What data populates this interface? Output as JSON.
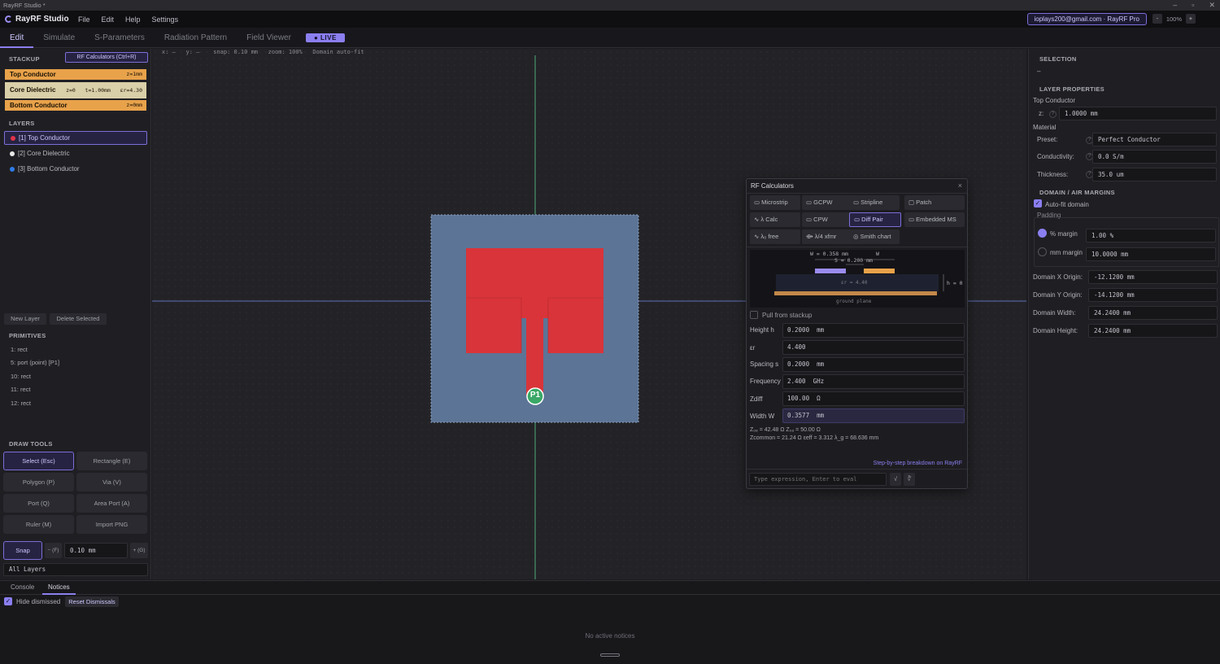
{
  "window": {
    "title": "RayRF Studio *"
  },
  "app": {
    "name": "RayRF Studio"
  },
  "menu": [
    "File",
    "Edit",
    "Help",
    "Settings"
  ],
  "account": {
    "label": "ioplays200@gmail.com · RayRF Pro"
  },
  "zoom": {
    "minus": "-",
    "value": "100%",
    "plus": "+"
  },
  "mode_tabs": [
    "Edit",
    "Simulate",
    "S-Parameters",
    "Radiation Pattern",
    "Field Viewer"
  ],
  "live_badge": "● LIVE",
  "stackup": {
    "heading": "STACKUP",
    "calc_button": "RF Calculators (Ctrl+R)",
    "rows": [
      {
        "name": "Top Conductor",
        "meta": "z=1mm",
        "color": "#e8a24a"
      },
      {
        "name": "Core Dielectric",
        "meta": "z=0   t=1.00mm   εr=4.30",
        "color": "#d9cfa8"
      },
      {
        "name": "Bottom Conductor",
        "meta": "z=0mm",
        "color": "#e8a24a"
      }
    ]
  },
  "layers": {
    "heading": "LAYERS",
    "items": [
      {
        "label": "[1] Top Conductor",
        "color": "#e0334a"
      },
      {
        "label": "[2] Core Dielectric",
        "color": "#e8e8e8"
      },
      {
        "label": "[3] Bottom Conductor",
        "color": "#2f7be6"
      }
    ],
    "new_button": "New Layer",
    "delete_button": "Delete Selected"
  },
  "primitives": {
    "heading": "PRIMITIVES",
    "items": [
      "1: rect",
      "5: port (point) [P1]",
      "10: rect",
      "11: rect",
      "12: rect"
    ]
  },
  "draw_tools": {
    "heading": "DRAW TOOLS",
    "tools": [
      "Select (Esc)",
      "Rectangle (E)",
      "Polygon (P)",
      "Via (V)",
      "Port (Q)",
      "Area Port (A)",
      "Ruler (M)",
      "Import PNG"
    ],
    "snap_label": "Snap",
    "snap_minus": "− (F)",
    "snap_value": "0.10 mm",
    "snap_plus": "+ (G)",
    "layer_filter": "All Layers"
  },
  "canvas": {
    "status": "x: —   y: —    snap: 0.10 mm   zoom: 100%   Domain auto-fit",
    "port_label": "P1"
  },
  "rf_calc": {
    "title": "RF Calculators",
    "close": "×",
    "tabs": [
      "Microstrip",
      "GCPW",
      "Stripline",
      "Patch",
      "λ Calc",
      "CPW",
      "Diff Pair",
      "Embedded MS",
      "λ₀ free",
      "λ/4 xfmr",
      "Smith chart"
    ],
    "active_tab": "Diff Pair",
    "diagram": {
      "w_label": "W = 0.358 mm",
      "w2_label": "W",
      "s_label": "S = 0.200 mm",
      "er_label": "εr = 4.40",
      "h_label": "h = 0",
      "ground_label": "ground plane"
    },
    "pull_from_stackup": "Pull from stackup",
    "fields": [
      {
        "label": "Height h",
        "value": "0.2000",
        "unit": "mm"
      },
      {
        "label": "εr",
        "value": "4.400",
        "unit": ""
      },
      {
        "label": "Spacing s",
        "value": "0.2000",
        "unit": "mm"
      },
      {
        "label": "Frequency",
        "value": "2.400",
        "unit": "GHz"
      },
      {
        "label": "Zdiff",
        "value": "100.00",
        "unit": "Ω"
      },
      {
        "label": "Width W",
        "value": "0.3577",
        "unit": "mm"
      }
    ],
    "result_line1": "Z₀ₑ = 42.48 Ω   Z₀ₒ = 50.00 Ω",
    "result_line2": "Zcommon = 21.24 Ω   εeff = 3.312   λ_g = 68.636 mm",
    "breakdown_link": "Step-by-step breakdown on RayRF",
    "expr_placeholder": "Type expression, Enter to eval",
    "expr_btn1": "√",
    "expr_btn2": "∛"
  },
  "right_panel": {
    "selection_heading": "SELECTION",
    "selection_value": "–",
    "layer_props_heading": "LAYER PROPERTIES",
    "layer_name": "Top Conductor",
    "z_label": "z:",
    "z_value": "1.0000 mm",
    "material_label": "Material",
    "preset_label": "Preset:",
    "preset_value": "Perfect Conductor",
    "conductivity_label": "Conductivity:",
    "conductivity_value": "0.0 S/m",
    "thickness_label": "Thickness:",
    "thickness_value": "35.0 um",
    "domain_heading": "DOMAIN / AIR MARGINS",
    "autofit_label": "Auto-fit domain",
    "padding_label": "Padding",
    "pct_margin_label": "% margin",
    "pct_margin_value": "1.00 %",
    "mm_margin_label": "mm margin",
    "mm_margin_value": "10.0000 mm",
    "domain_fields": [
      {
        "label": "Domain X Origin:",
        "value": "-12.1200 mm"
      },
      {
        "label": "Domain Y Origin:",
        "value": "-14.1200 mm"
      },
      {
        "label": "Domain Width:",
        "value": "24.2400 mm"
      },
      {
        "label": "Domain Height:",
        "value": "24.2400 mm"
      }
    ]
  },
  "bottom": {
    "tabs": [
      "Console",
      "Notices"
    ],
    "hide_dismissed": "Hide dismissed",
    "reset_dismissals": "Reset Dismissals",
    "empty_text": "No active notices"
  }
}
